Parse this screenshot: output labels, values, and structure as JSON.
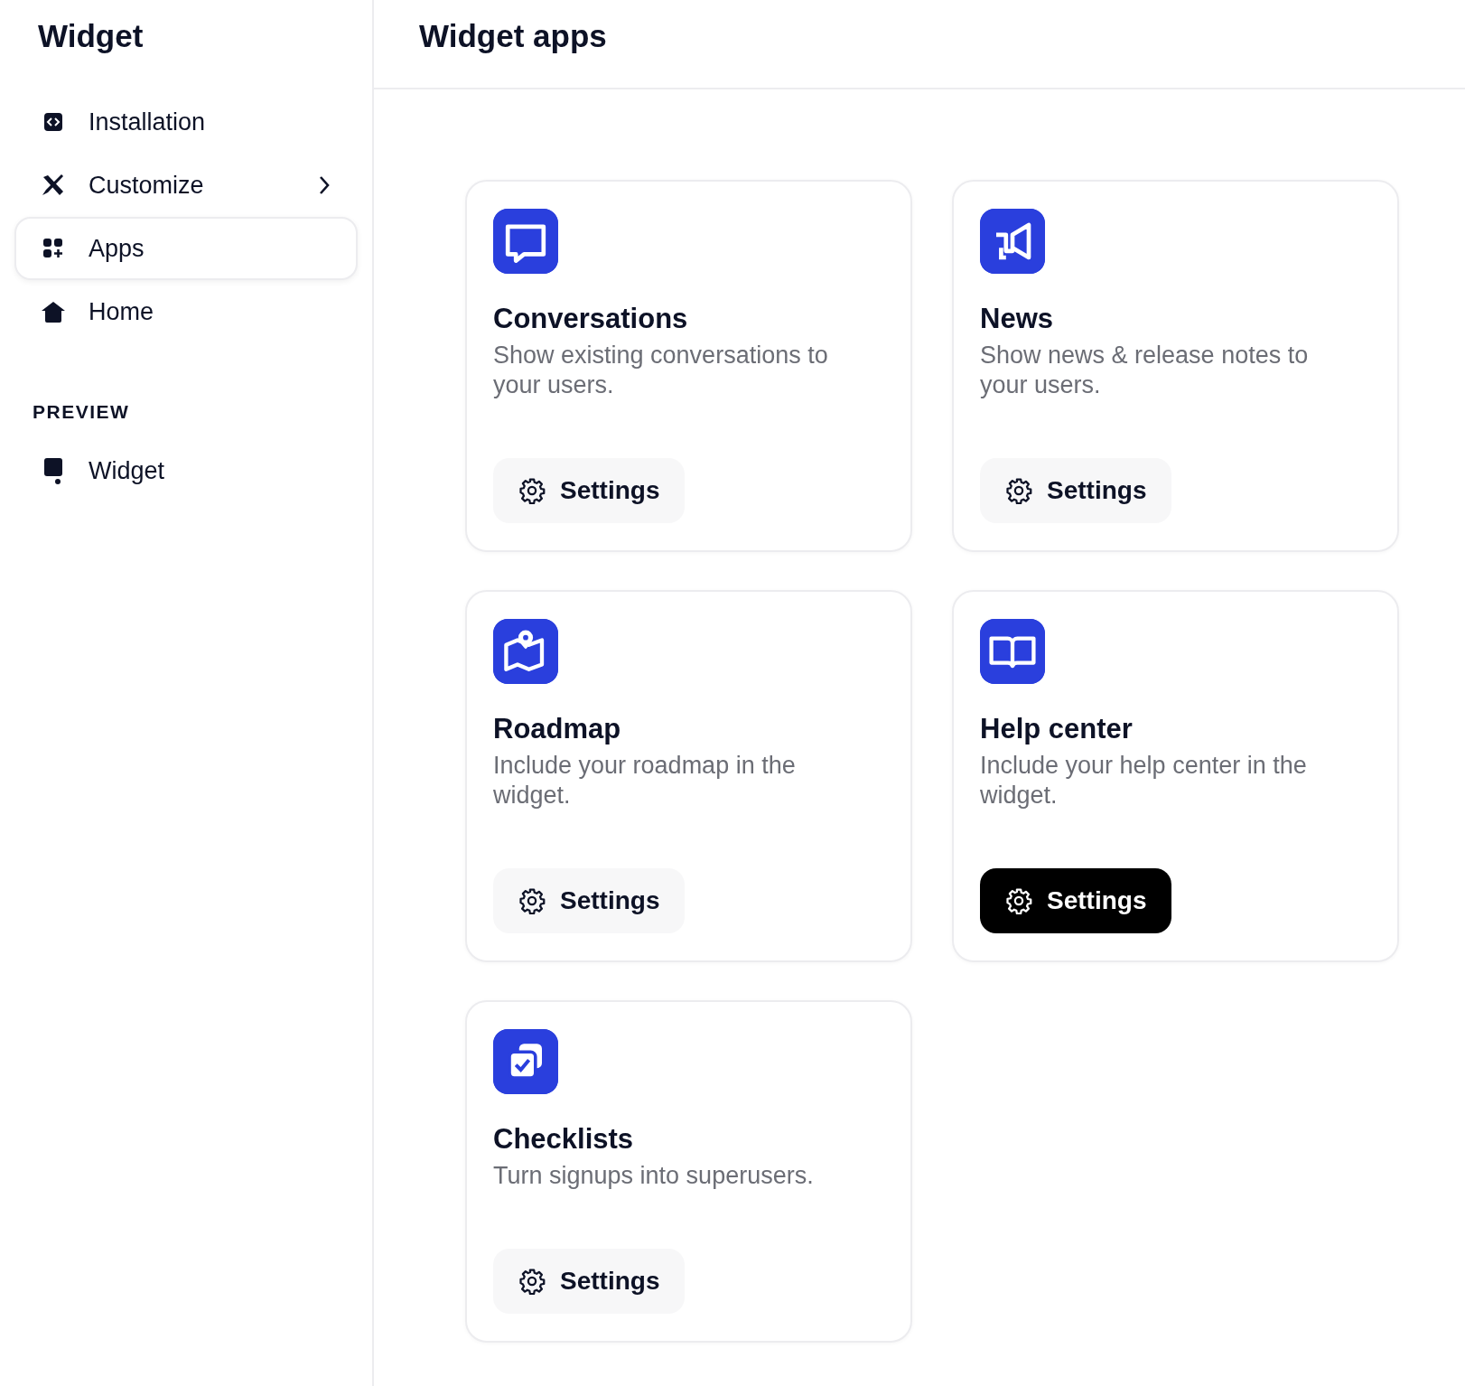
{
  "sidebar": {
    "title": "Widget",
    "items": [
      {
        "kind": "link",
        "label": "Installation",
        "selected": false
      },
      {
        "kind": "group",
        "label": "Customize",
        "selected": false,
        "expanded": false
      },
      {
        "kind": "link",
        "label": "Apps",
        "selected": true
      },
      {
        "kind": "link",
        "label": "Home",
        "selected": false
      }
    ],
    "sections": [
      {
        "heading": "PREVIEW",
        "items": [
          {
            "label": "Widget",
            "selected": false
          }
        ]
      }
    ]
  },
  "main": {
    "title": "Widget apps",
    "apps": [
      {
        "name": "Conversations",
        "description": "Show existing conversations to your users.",
        "button": "Settings",
        "active": false
      },
      {
        "name": "News",
        "description": "Show news & release notes to your users.",
        "button": "Settings",
        "active": false
      },
      {
        "name": "Roadmap",
        "description": "Include your roadmap in the widget.",
        "button": "Settings",
        "active": false
      },
      {
        "name": "Help center",
        "description": "Include your help center in the widget.",
        "button": "Settings",
        "active": true
      },
      {
        "name": "Checklists",
        "description": "Turn signups into superusers.",
        "button": "Settings",
        "active": false
      }
    ]
  }
}
